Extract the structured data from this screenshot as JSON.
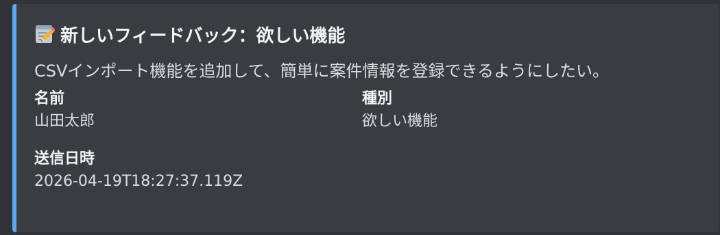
{
  "embed": {
    "accent_color": "#5aa9f0",
    "icon": "memo-icon",
    "title": "新しいフィードバック：欲しい機能",
    "description": "CSVインポート機能を追加して、簡単に案件情報を登録できるようにしたい。",
    "fields": [
      {
        "name": "名前",
        "value": "山田太郎"
      },
      {
        "name": "種別",
        "value": "欲しい機能"
      },
      {
        "name": "送信日時",
        "value": "2026-04-19T18:27:37.119Z"
      }
    ]
  }
}
